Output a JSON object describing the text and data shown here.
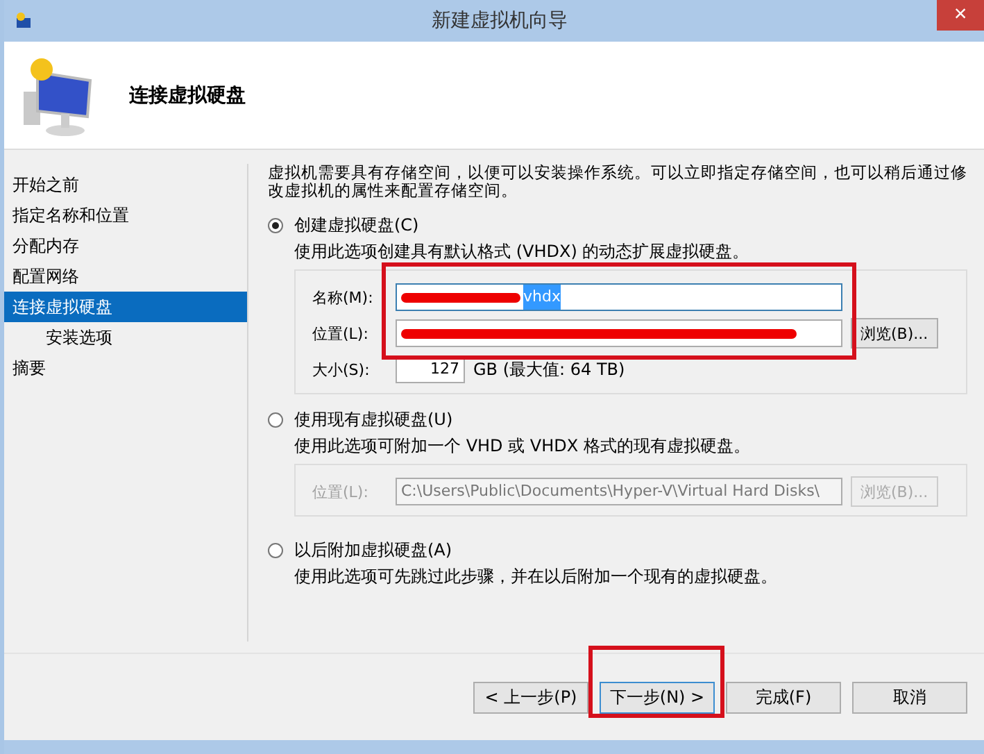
{
  "window": {
    "title": "新建虚拟机向导",
    "close": "×"
  },
  "header": {
    "title": "连接虚拟硬盘"
  },
  "sidebar": {
    "items": [
      {
        "label": "开始之前",
        "selected": false
      },
      {
        "label": "指定名称和位置",
        "selected": false
      },
      {
        "label": "分配内存",
        "selected": false
      },
      {
        "label": "配置网络",
        "selected": false
      },
      {
        "label": "连接虚拟硬盘",
        "selected": true,
        "children": [
          {
            "label": "安装选项",
            "selected": false
          }
        ]
      },
      {
        "label": "摘要",
        "selected": false
      }
    ]
  },
  "intro": "虚拟机需要具有存储空间，以便可以安装操作系统。可以立即指定存储空间，也可以稍后通过修改虚拟机的属性来配置存储空间。",
  "options": [
    {
      "kind": "create",
      "label": "创建虚拟硬盘(C)",
      "selected": true,
      "description": "使用此选项创建具有默认格式 (VHDX) 的动态扩展虚拟硬盘。",
      "name_label": "名称(M):",
      "name_value": "vhdx",
      "location_label": "位置(L):",
      "browse": "浏览(B)...",
      "size_label": "大小(S):",
      "size_value": "127",
      "size_note": "GB (最大值: 64 TB)"
    },
    {
      "kind": "existing",
      "label": "使用现有虚拟硬盘(U)",
      "selected": false,
      "description": "使用此选项可附加一个 VHD 或 VHDX 格式的现有虚拟硬盘。",
      "location_label": "位置(L):",
      "location_value": "C:\\Users\\Public\\Documents\\Hyper-V\\Virtual Hard Disks\\",
      "browse": "浏览(B)...",
      "disabled": true
    },
    {
      "kind": "later",
      "label": "以后附加虚拟硬盘(A)",
      "selected": false,
      "description": "使用此选项可先跳过此步骤，并在以后附加一个现有的虚拟硬盘。"
    }
  ],
  "buttons": [
    {
      "label": "< 上一步(P)",
      "focused": false
    },
    {
      "label": "下一步(N) >",
      "focused": true
    },
    {
      "label": "完成(F)",
      "focused": false
    },
    {
      "label": "取消",
      "focused": false
    }
  ]
}
